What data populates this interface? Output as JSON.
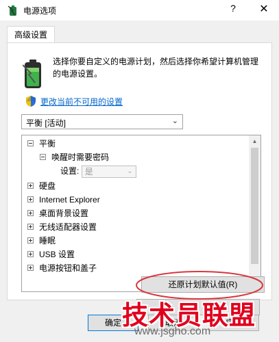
{
  "window": {
    "title": "电源选项",
    "help_glyph": "?",
    "close_glyph": "✕",
    "icon": "power-options-icon"
  },
  "tab": {
    "label": "高级设置"
  },
  "description": "选择你要自定义的电源计划，然后选择你希望计算机管理的电源设置。",
  "change_unavailable_link": "更改当前不可用的设置",
  "plan_select": {
    "value": "平衡 [活动]"
  },
  "tree": {
    "items": [
      {
        "label": "平衡",
        "expander": "minus"
      },
      {
        "label": "唤醒时需要密码",
        "expander": "minus"
      },
      {
        "label": "设置:",
        "value": "是"
      },
      {
        "label": "硬盘",
        "expander": "plus"
      },
      {
        "label": "Internet Explorer",
        "expander": "plus"
      },
      {
        "label": "桌面背景设置",
        "expander": "plus"
      },
      {
        "label": "无线适配器设置",
        "expander": "plus"
      },
      {
        "label": "睡眠",
        "expander": "plus"
      },
      {
        "label": "USB 设置",
        "expander": "plus"
      },
      {
        "label": "电源按钮和盖子",
        "expander": "plus"
      }
    ]
  },
  "restore_button": "还原计划默认值(R)",
  "buttons": {
    "ok": "确定",
    "cancel": "取消",
    "apply": "应用"
  },
  "watermark": {
    "text": "技术员联盟",
    "url": "www.jsgho.com"
  },
  "colors": {
    "link": "#0066cc",
    "highlight_ellipse": "#d9363e",
    "watermark_red": "#e0001e"
  }
}
